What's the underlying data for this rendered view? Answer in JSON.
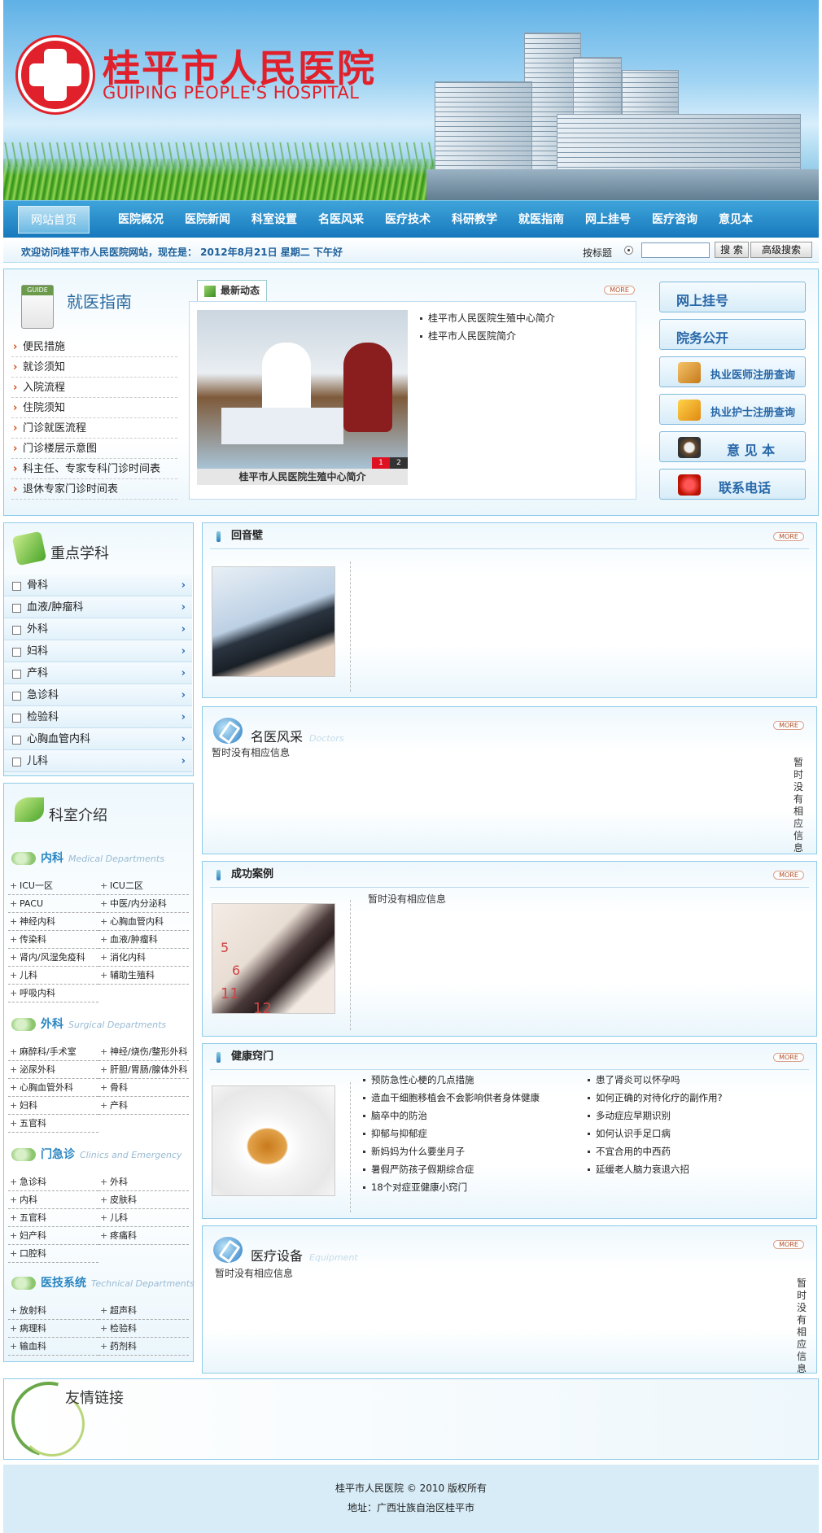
{
  "header": {
    "name_cn": "桂平市人民医院",
    "name_en": "GUIPING PEOPLE'S HOSPITAL"
  },
  "nav": [
    "网站首页",
    "医院概况",
    "医院新闻",
    "科室设置",
    "名医风采",
    "医疗技术",
    "科研教学",
    "就医指南",
    "网上挂号",
    "医疗咨询",
    "意见本"
  ],
  "welcome": {
    "text": "欢迎访问桂平市人民医院网站，现在是： 2012年8月21日 星期二 下午好",
    "search_label": "按标题",
    "search_btn": "搜 索",
    "adv_btn": "高级搜索"
  },
  "guide": {
    "title": "就医指南",
    "items": [
      "便民措施",
      "就诊须知",
      "入院流程",
      "住院须知",
      "门诊就医流程",
      "门诊楼层示意图",
      "科主任、专家专科门诊时间表",
      "退休专家门诊时间表"
    ]
  },
  "news": {
    "tab": "最新动态",
    "more": "MORE",
    "caption": "桂平市人民医院生殖中心简介",
    "pages": [
      "1",
      "2"
    ],
    "items": [
      "桂平市人民医院生殖中心简介",
      "桂平市人民医院简介"
    ]
  },
  "right_buttons": [
    "网上挂号",
    "院务公开",
    "执业医师注册查询",
    "执业护士注册查询",
    "意 见 本",
    "联系电话"
  ],
  "key_depts": {
    "title": "重点学科",
    "items": [
      "骨科",
      "血液/肿瘤科",
      "外科",
      "妇科",
      "产科",
      "急诊科",
      "检验科",
      "心胸血管内科",
      "儿科"
    ]
  },
  "dept_intro": {
    "title": "科室介绍",
    "groups": [
      {
        "name": "内科",
        "en": "Medical Departments",
        "items": [
          "ICU一区",
          "ICU二区",
          "PACU",
          "中医/内分泌科",
          "神经内科",
          "心胸血管内科",
          "传染科",
          "血液/肿瘤科",
          "肾内/风湿免疫科",
          "消化内科",
          "儿科",
          "辅助生殖科",
          "呼吸内科"
        ]
      },
      {
        "name": "外科",
        "en": "Surgical Departments",
        "items": [
          "麻醉科/手术室",
          "神经/烧伤/整形外科",
          "泌尿外科",
          "肝胆/胃肠/腺体外科",
          "心胸血管外科",
          "骨科",
          "妇科",
          "产科",
          "五官科"
        ]
      },
      {
        "name": "门急诊",
        "en": "Clinics and Emergency",
        "items": [
          "急诊科",
          "外科",
          "内科",
          "皮肤科",
          "五官科",
          "儿科",
          "妇产科",
          "疼痛科",
          "口腔科"
        ]
      },
      {
        "name": "医技系统",
        "en": "Technical Departments",
        "items": [
          "放射科",
          "超声科",
          "病理科",
          "检验科",
          "输血科",
          "药剂科"
        ]
      }
    ]
  },
  "echo": {
    "title": "回音壁",
    "more": "MORE"
  },
  "doctors": {
    "title": "名医风采",
    "en": "Doctors",
    "more": "MORE",
    "empty": "暂时没有相应信息",
    "vempty": "暂时没有相应信息"
  },
  "cases": {
    "title": "成功案例",
    "more": "MORE",
    "empty": "暂时没有相应信息",
    "photo_digits": [
      "5",
      "6",
      "11",
      "12"
    ]
  },
  "health": {
    "title": "健康窍门",
    "more": "MORE",
    "col1": [
      "预防急性心梗的几点措施",
      "造血干细胞移植会不会影响供者身体健康",
      "脑卒中的防治",
      "抑郁与抑郁症",
      "新妈妈为什么要坐月子",
      "暑假严防孩子假期综合症",
      "18个对症亚健康小窍门"
    ],
    "col2": [
      "患了肾炎可以怀孕吗",
      "如何正确的对待化疗的副作用?",
      "多动症应早期识别",
      "如何认识手足口病",
      "不宜合用的中西药",
      "延缓老人脑力衰退六招"
    ]
  },
  "equipment": {
    "title": "医疗设备",
    "en": "Equipment",
    "more": "MORE",
    "empty": "暂时没有相应信息",
    "vempty": "暂时没有相应信息"
  },
  "links": {
    "title": "友情链接"
  },
  "footer": {
    "line1": "桂平市人民医院 © 2010 版权所有",
    "line2": "地址：广西壮族自治区桂平市"
  }
}
